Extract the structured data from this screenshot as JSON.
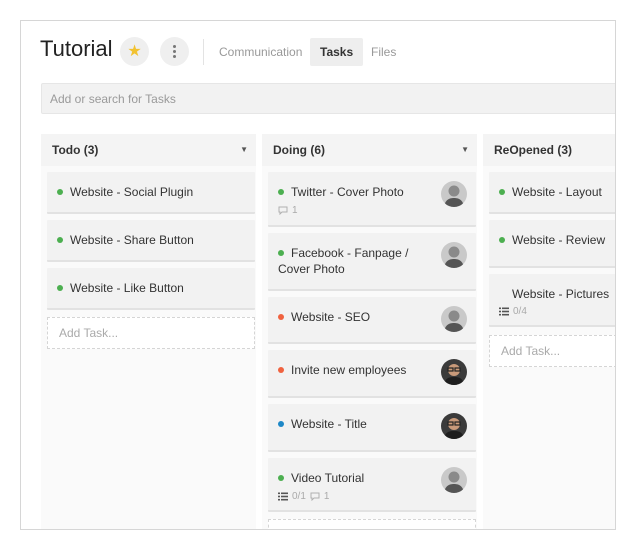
{
  "header": {
    "title": "Tutorial",
    "tabs": [
      {
        "label": "Communication",
        "active": false
      },
      {
        "label": "Tasks",
        "active": true
      },
      {
        "label": "Files",
        "active": false
      }
    ]
  },
  "search": {
    "placeholder": "Add or search for Tasks"
  },
  "colors": {
    "green": "#4caf50",
    "red": "#f0623f",
    "blue": "#1e88c7",
    "star": "#f2c230"
  },
  "columns": [
    {
      "name": "Todo (3)",
      "cards": [
        {
          "title": "Website - Social Plugin",
          "status": "green"
        },
        {
          "title": "Website - Share Button",
          "status": "green"
        },
        {
          "title": "Website - Like Button",
          "status": "green"
        }
      ],
      "add_label": "Add Task..."
    },
    {
      "name": "Doing (6)",
      "cards": [
        {
          "title": "Twitter - Cover Photo",
          "status": "green",
          "comments": "1",
          "avatar": "man-gray"
        },
        {
          "title": "Facebook - Fanpage / Cover Photo",
          "status": "green",
          "avatar": "man-gray"
        },
        {
          "title": "Website - SEO",
          "status": "red",
          "avatar": "man-gray"
        },
        {
          "title": "Invite new employees",
          "status": "red",
          "avatar": "man-glasses"
        },
        {
          "title": "Website - Title",
          "status": "blue",
          "avatar": "man-glasses"
        },
        {
          "title": "Video Tutorial",
          "status": "green",
          "checklist": "0/1",
          "comments": "1",
          "avatar": "man-gray"
        }
      ]
    },
    {
      "name": "ReOpened (3)",
      "cards": [
        {
          "title": "Website - Layout",
          "status": "green"
        },
        {
          "title": "Website - Review",
          "status": "green"
        },
        {
          "title": "Website - Pictures",
          "status": "none",
          "checklist": "0/4"
        }
      ],
      "add_label": "Add Task..."
    }
  ]
}
